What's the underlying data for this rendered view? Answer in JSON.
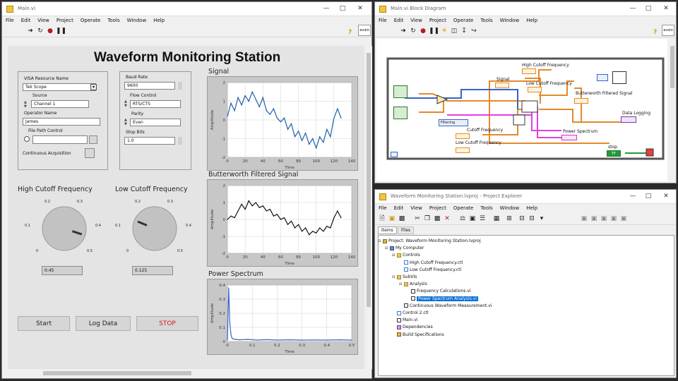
{
  "colors": {
    "accent": "#0a6fd6",
    "wire_orange": "#e4892c",
    "wire_pink": "#e040e0",
    "wire_blue": "#3a62c8",
    "wire_green": "#1f9a3a",
    "stop_text": "#d32020",
    "signal_line": "#1f5fa8",
    "filtered_line": "#111111",
    "spectrum_line": "#3a62c8"
  },
  "front_panel": {
    "title": "Main.vi",
    "menu": [
      "File",
      "Edit",
      "View",
      "Project",
      "Operate",
      "Tools",
      "Window",
      "Help"
    ],
    "help_icon": "question-icon",
    "vi_icon_text": "avalo",
    "heading": "Waveform Monitoring Station",
    "visa": {
      "resource_label": "VISA Resource Name",
      "resource_value": "Tek Scope",
      "source_label": "Source",
      "source_value": "Channel 1",
      "operator_label": "Operator Name",
      "operator_value": "James",
      "file_path_label": "File Path Control",
      "continuous_label": "Continuous Acquisition"
    },
    "serial": {
      "baud_label": "Baud Rate",
      "baud_value": "9600",
      "flow_label": "Flow Control",
      "flow_value": "RTS/CTS",
      "parity_label": "Parity",
      "parity_value": "Even",
      "stop_label": "Stop Bits",
      "stop_value": "1.0"
    },
    "high_knob": {
      "label": "High Cutoff Frequency",
      "ticks": [
        "0.2",
        "0.3",
        "0.1",
        "0.4",
        "0",
        "0.5"
      ],
      "value": 0.45,
      "value_text": "0.45"
    },
    "low_knob": {
      "label": "Low Cutoff Frequency",
      "ticks": [
        "0.2",
        "0.3",
        "0.1",
        "0.4",
        "0",
        "0.5"
      ],
      "value": 0.125,
      "value_text": "0.125"
    },
    "buttons": {
      "start": "Start",
      "log": "Log Data",
      "stop": "STOP"
    },
    "charts": {
      "signal": {
        "label": "Signal",
        "ylabel": "Amplitude",
        "xlabel": "Time"
      },
      "filtered": {
        "label": "Butterworth Filtered Signal",
        "ylabel": "Amplitude",
        "xlabel": "Time"
      },
      "spectrum": {
        "label": "Power Spectrum",
        "ylabel": "Amplitude",
        "xlabel": "Time"
      }
    }
  },
  "chart_data": [
    {
      "type": "line",
      "title": "Signal",
      "xlabel": "Time",
      "ylabel": "Amplitude",
      "xlim": [
        0,
        140
      ],
      "ylim": [
        -2,
        2
      ],
      "xticks": [
        "0",
        "20",
        "40",
        "60",
        "80",
        "100",
        "120",
        "140"
      ],
      "yticks": [
        "2",
        "1",
        "0",
        "-1",
        "-2"
      ],
      "x": [
        0,
        4,
        8,
        12,
        16,
        20,
        24,
        28,
        32,
        36,
        40,
        44,
        48,
        52,
        56,
        60,
        64,
        68,
        72,
        76,
        80,
        84,
        88,
        92,
        96,
        100,
        104,
        108,
        112,
        116,
        120,
        124,
        128
      ],
      "y": [
        0.2,
        0.9,
        0.5,
        1.2,
        0.8,
        1.3,
        1.0,
        1.5,
        1.1,
        0.7,
        1.2,
        0.5,
        0.3,
        0.6,
        0.1,
        -0.1,
        0.1,
        -0.5,
        -0.2,
        -0.9,
        -0.6,
        -1.1,
        -0.7,
        -1.3,
        -1.0,
        -1.5,
        -0.9,
        -1.2,
        -0.5,
        -0.9,
        0.1,
        0.6,
        0.1
      ]
    },
    {
      "type": "line",
      "title": "Butterworth Filtered Signal",
      "xlabel": "Time",
      "ylabel": "Amplitude",
      "xlim": [
        0,
        140
      ],
      "ylim": [
        -2,
        2
      ],
      "xticks": [
        "0",
        "20",
        "40",
        "60",
        "80",
        "100",
        "120",
        "140"
      ],
      "yticks": [
        "2",
        "1",
        "0",
        "-1",
        "-2"
      ],
      "x": [
        0,
        4,
        8,
        12,
        16,
        20,
        24,
        28,
        32,
        36,
        40,
        44,
        48,
        52,
        56,
        60,
        64,
        68,
        72,
        76,
        80,
        84,
        88,
        92,
        96,
        100,
        104,
        108,
        112,
        116,
        120,
        124,
        128
      ],
      "y": [
        0.0,
        0.2,
        0.1,
        0.5,
        0.9,
        0.6,
        1.1,
        0.8,
        1.0,
        0.7,
        0.8,
        0.5,
        0.6,
        0.2,
        0.3,
        0.0,
        0.1,
        -0.3,
        -0.1,
        -0.5,
        -0.3,
        -0.7,
        -0.5,
        -0.9,
        -0.7,
        -0.8,
        -0.5,
        -0.7,
        -0.4,
        -0.5,
        0.1,
        0.5,
        0.1
      ]
    },
    {
      "type": "line",
      "title": "Power Spectrum",
      "xlabel": "Time",
      "ylabel": "Amplitude",
      "xlim": [
        0,
        0.5
      ],
      "ylim": [
        0,
        0.4
      ],
      "xticks": [
        "0",
        "0.1",
        "0.2",
        "0.3",
        "0.4",
        "0.5"
      ],
      "yticks": [
        "0.4",
        "0.3",
        "0.2",
        "0.1",
        "0"
      ],
      "x": [
        0,
        0.005,
        0.01,
        0.015,
        0.02,
        0.03,
        0.05,
        0.08,
        0.12,
        0.16,
        0.2,
        0.25,
        0.3,
        0.35,
        0.4,
        0.45,
        0.5
      ],
      "y": [
        0.01,
        0.38,
        0.12,
        0.04,
        0.02,
        0.015,
        0.012,
        0.015,
        0.01,
        0.013,
        0.01,
        0.012,
        0.01,
        0.011,
        0.01,
        0.012,
        0.01
      ]
    }
  ],
  "block_diagram": {
    "title": "Main.vi Block Diagram",
    "menu": [
      "File",
      "Edit",
      "View",
      "Project",
      "Operate",
      "Tools",
      "Window",
      "Help"
    ],
    "labels": {
      "high": "High Cutoff Frequency",
      "low_top": "Low Cutoff Frequency",
      "signal": "Signal",
      "filtered": "Butterworth Filtered Signal",
      "data_logging": "Data Logging",
      "power": "Power Spectrum",
      "cutoff_mid": "Cutoff Frequency",
      "low_bottom": "Low Cutoff Frequency",
      "stop": "stop",
      "filter_node": "Filtering",
      "stop_node": "TF"
    }
  },
  "project_explorer": {
    "title": "Waveform Monitoring Station.lvproj - Project Explorer",
    "menu": [
      "File",
      "Edit",
      "View",
      "Project",
      "Operate",
      "Tools",
      "Window",
      "Help"
    ],
    "tabs": [
      "Items",
      "Files"
    ],
    "tree": [
      {
        "label": "Project: Waveform Monitoring Station.lvproj",
        "level": 0,
        "icon": "project-icon"
      },
      {
        "label": "My Computer",
        "level": 1,
        "icon": "computer-icon"
      },
      {
        "label": "Controls",
        "level": 2,
        "icon": "folder-icon"
      },
      {
        "label": "High Cutoff Frequency.ctl",
        "level": 3,
        "icon": "control-icon"
      },
      {
        "label": "Low Cutoff Frequency.ctl",
        "level": 3,
        "icon": "control-icon"
      },
      {
        "label": "SubVIs",
        "level": 2,
        "icon": "folder-icon"
      },
      {
        "label": "Analysis",
        "level": 3,
        "icon": "folder-icon"
      },
      {
        "label": "Frequency Calculations.vi",
        "level": 4,
        "icon": "vi-icon"
      },
      {
        "label": "Power Spectrum Analysis.vi",
        "level": 4,
        "icon": "vi-icon",
        "selected": true
      },
      {
        "label": "Continuous Waveform Measurement.vi",
        "level": 3,
        "icon": "vi-icon"
      },
      {
        "label": "Control 2.ctl",
        "level": 2,
        "icon": "control-icon"
      },
      {
        "label": "Main.vi",
        "level": 2,
        "icon": "vi-icon"
      },
      {
        "label": "Dependencies",
        "level": 2,
        "icon": "dependencies-icon"
      },
      {
        "label": "Build Specifications",
        "level": 2,
        "icon": "build-icon"
      }
    ]
  }
}
